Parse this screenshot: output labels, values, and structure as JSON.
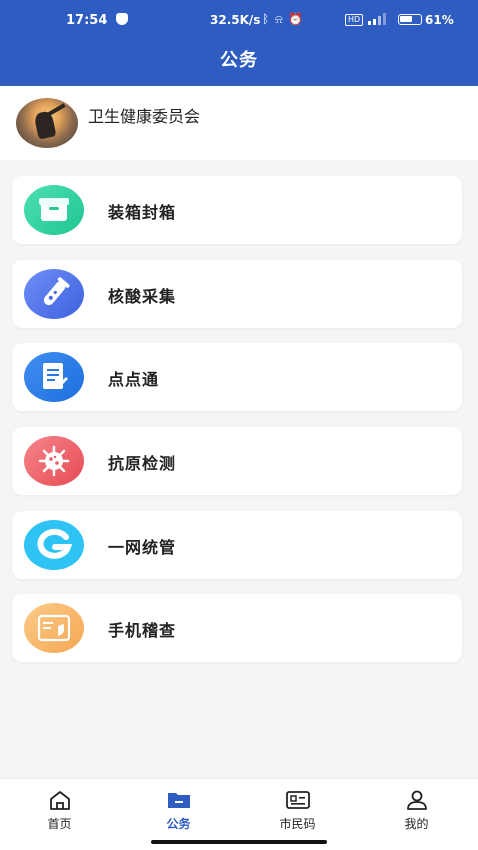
{
  "status_bar": {
    "time": "17:54",
    "net_speed": "32.5K/s",
    "battery": "61%",
    "battery_level": 0.61,
    "hd": "HD"
  },
  "header": {
    "title": "公务"
  },
  "org": {
    "name": "卫生健康委员会"
  },
  "menu": [
    {
      "label": "装箱封箱",
      "icon": "box-icon",
      "color_start": "#4ee0b4",
      "color_end": "#1fc492"
    },
    {
      "label": "核酸采集",
      "icon": "test-tube-icon",
      "color_start": "#6f8df5",
      "color_end": "#3e62e0"
    },
    {
      "label": "点点通",
      "icon": "document-icon",
      "color_start": "#3f8ef0",
      "color_end": "#1e6fdf"
    },
    {
      "label": "抗原检测",
      "icon": "virus-icon",
      "color_start": "#f6858a",
      "color_end": "#e64b54"
    },
    {
      "label": "一网统管",
      "icon": "g-logo-icon",
      "color_start": "#2fc3f5",
      "color_end": "#2fc3f5"
    },
    {
      "label": "手机稽查",
      "icon": "id-card-icon",
      "color_start": "#fbcb88",
      "color_end": "#f5a653"
    }
  ],
  "tabbar": [
    {
      "label": "首页",
      "icon": "home-icon"
    },
    {
      "label": "公务",
      "icon": "folder-icon",
      "active": true
    },
    {
      "label": "市民码",
      "icon": "citizen-card-icon"
    },
    {
      "label": "我的",
      "icon": "user-icon"
    }
  ],
  "colors": {
    "primary": "#2f5cc0",
    "background": "#f4f5f7"
  }
}
